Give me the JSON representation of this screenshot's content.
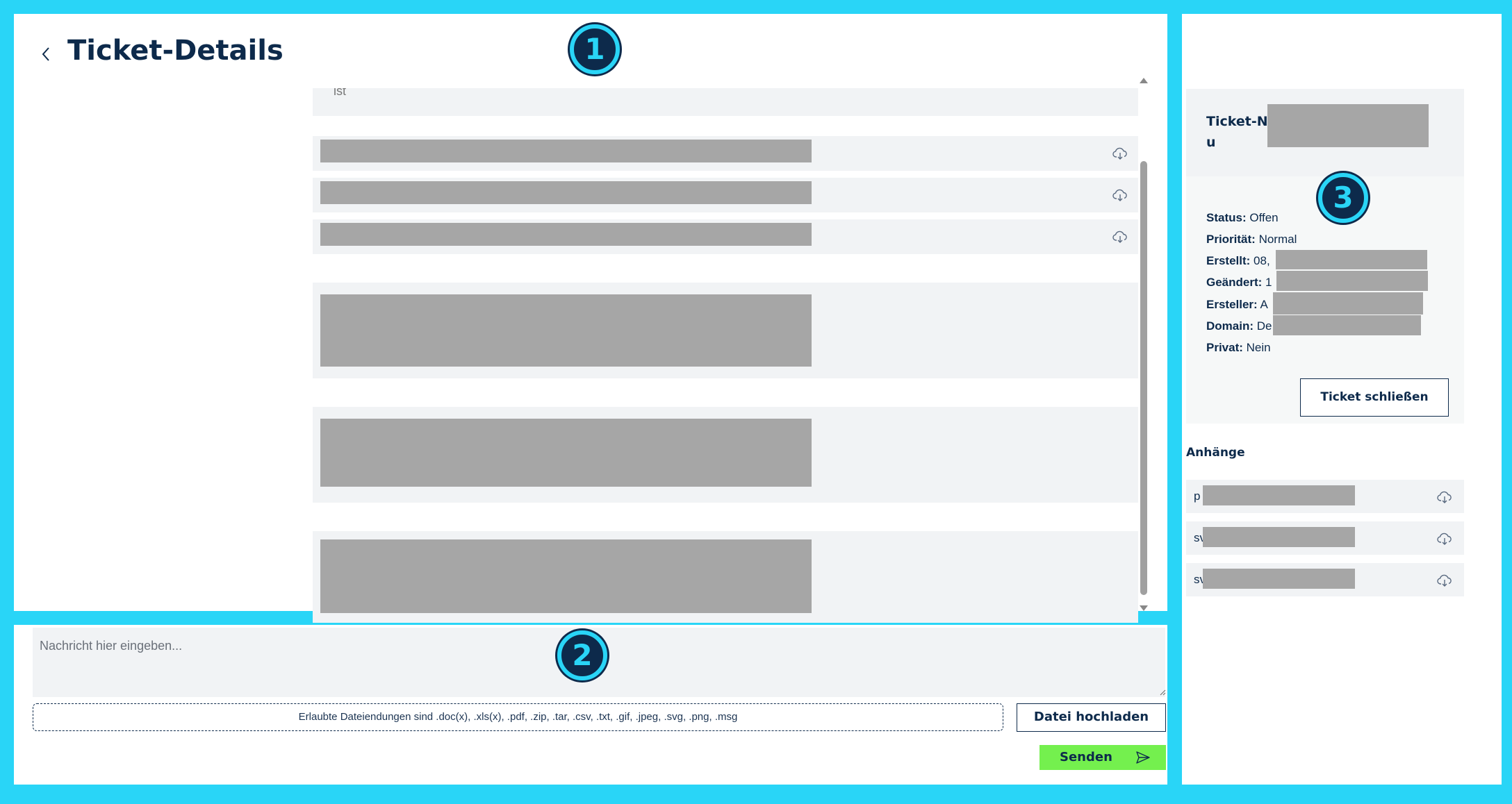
{
  "header": {
    "title": "Ticket-Details",
    "back_icon": "chevron-left-icon"
  },
  "badges": [
    "1",
    "2",
    "3"
  ],
  "messages": {
    "partial_text": "ist",
    "attachment_count": 3,
    "block_count": 3
  },
  "compose": {
    "placeholder": "Nachricht hier eingeben...",
    "allowed_files_text": "Erlaubte Dateiendungen sind .doc(x), .xls(x), .pdf, .zip, .tar, .csv, .txt, .gif, .jpeg, .svg, .png, .msg",
    "upload_label": "Datei hochladen",
    "send_label": "Senden"
  },
  "ticket": {
    "number_prefix": "Ticket-N",
    "subtitle_prefix": "u",
    "status_label": "Status:",
    "status_value": "Offen",
    "priority_label": "Priorität:",
    "priority_value": "Normal",
    "created_label": "Erstellt:",
    "created_value": "08,",
    "changed_label": "Geändert:",
    "changed_value": "1",
    "creator_label": "Ersteller:",
    "creator_value": "A",
    "domain_label": "Domain:",
    "domain_value": "De",
    "private_label": "Privat:",
    "private_value": "Nein",
    "close_label": "Ticket schließen"
  },
  "attachments": {
    "title": "Anhänge",
    "items": [
      {
        "name": "p"
      },
      {
        "name": "sv"
      },
      {
        "name": "sv"
      }
    ]
  },
  "colors": {
    "frame": "#29d5f7",
    "navy": "#0d2a4b",
    "send": "#74f04e",
    "redaction": "#a6a6a6"
  }
}
